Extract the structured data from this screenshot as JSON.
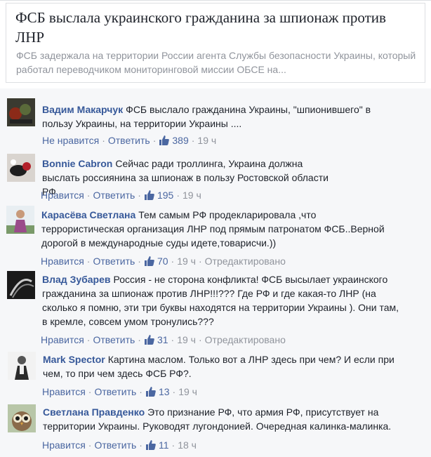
{
  "article": {
    "title": "ФСБ выслала украинского гражданина за шпионаж против ЛНР",
    "description": "ФСБ задержала на территории России агента Службы безопасности Украины, который работал переводчиком мониторинговой миссии ОБСЕ на..."
  },
  "comments": [
    {
      "author": "Вадим Макарчук",
      "text": "ФСБ выслало гражданина Украины, \"шпионившего\" в пользу Украины, на территории Украины ....",
      "like_label": "Не нравится",
      "reply_label": "Ответить",
      "likes": "389",
      "time": "19 ч",
      "edited": ""
    },
    {
      "author": "Bonnie Cabron",
      "text": "Сейчас ради троллинга, Украина должна выслать россиянина за шпионаж в пользу Ростовской области РФ.",
      "like_label": "Нравится",
      "reply_label": "Ответить",
      "likes": "195",
      "time": "19 ч",
      "edited": ""
    },
    {
      "author": "Карасёва Светлана",
      "text": "Тем самым РФ продекларировала ,что террористическая организация ЛНР под прямым патронатом ФСБ..Верной дорогой в международные суды идете,товарисчи.))",
      "like_label": "Нравится",
      "reply_label": "Ответить",
      "likes": "70",
      "time": "19 ч",
      "edited": "Отредактировано"
    },
    {
      "author": "Влад Зубарев",
      "text": "Россия - не сторона конфликта! ФСБ высылает украинского гражданина за шпионаж против ЛНР!!!??? Где РФ и где какая-то ЛНР (на сколько я помню, эти три буквы находятся на территории Украины ). Они там, в кремле, совсем умом тронулись???",
      "like_label": "Нравится",
      "reply_label": "Ответить",
      "likes": "31",
      "time": "19 ч",
      "edited": "Отредактировано"
    },
    {
      "author": "Mark Spector",
      "text": "Картина маслом. Только вот а ЛНР здесь при чем? И если при чем, то при чем здесь ФСБ РФ?.",
      "like_label": "Нравится",
      "reply_label": "Ответить",
      "likes": "13",
      "time": "19 ч",
      "edited": ""
    },
    {
      "author": "Светлана Правденко",
      "text": "Это признание РФ, что армия РФ, присутствует на территории Украины. Руководят лугондонией. Очередная калинка-малинка.",
      "like_label": "Нравится",
      "reply_label": "Ответить",
      "likes": "11",
      "time": "18 ч",
      "edited": ""
    }
  ],
  "colors": {
    "author": "#365899",
    "action_link": "#4b67a1",
    "meta": "#90949c",
    "background": "#f6f7f9"
  },
  "icons": {
    "like": "thumbs-up-icon"
  }
}
